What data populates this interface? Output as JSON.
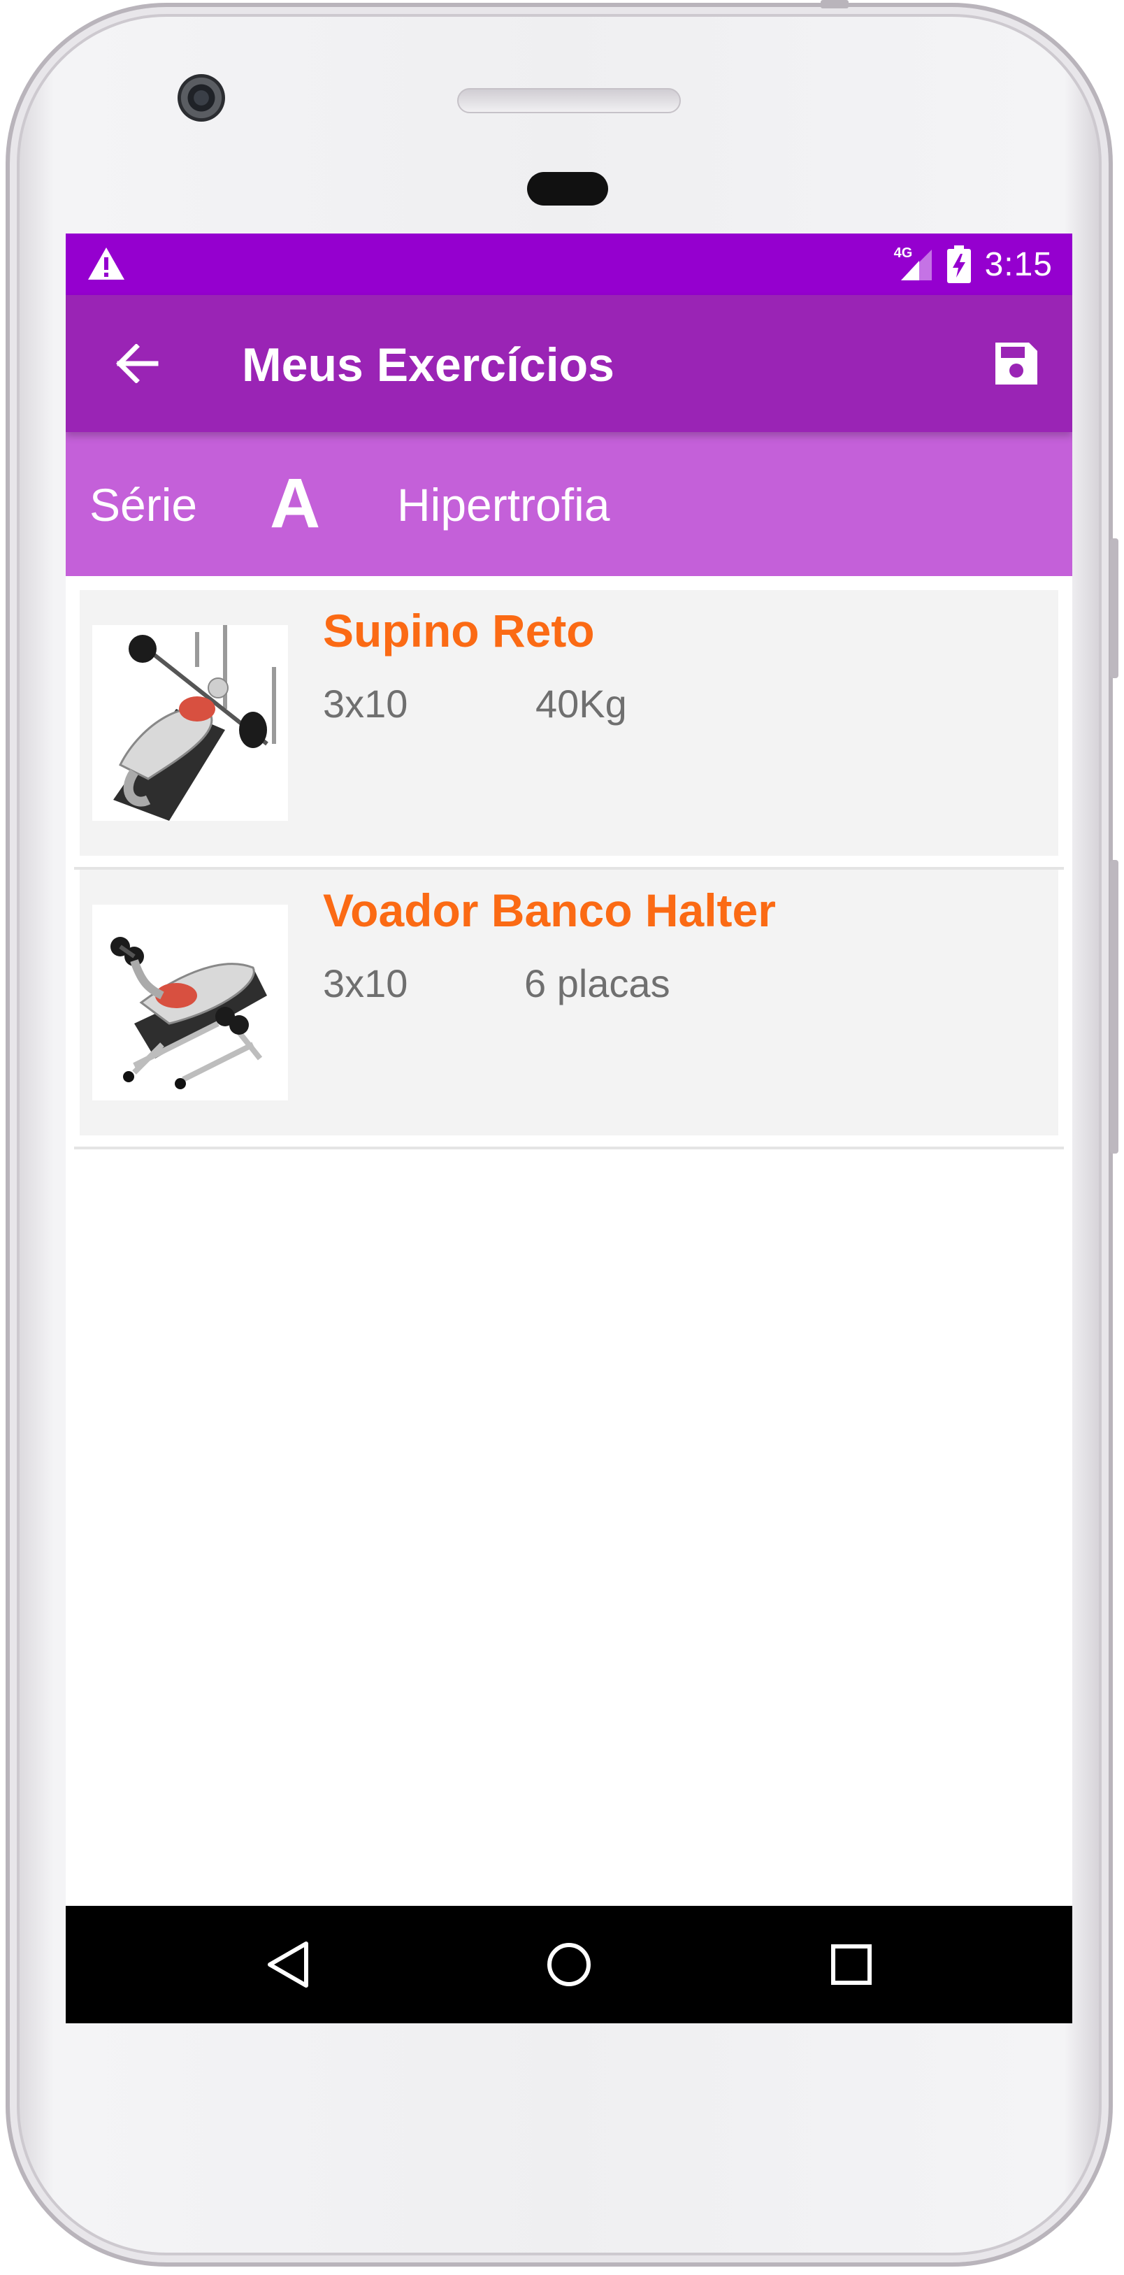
{
  "status_bar": {
    "network": "4G",
    "time": "3:15",
    "color": "#9500cf"
  },
  "app_bar": {
    "title": "Meus Exercícios",
    "color": "#9a24b5",
    "back_icon": "arrow-left-icon",
    "save_icon": "floppy-disk-icon"
  },
  "series": {
    "label": "Série",
    "letter": "A",
    "type": "Hipertrofia",
    "color": "#c460d9"
  },
  "exercises": [
    {
      "name": "Supino Reto",
      "sets": "3x10",
      "load": "40Kg",
      "image": "barbell-bench-press-illustration"
    },
    {
      "name": "Voador Banco Halter",
      "sets": "3x10",
      "load": "6 placas",
      "image": "dumbbell-fly-illustration"
    }
  ],
  "accent_color": "#fb6a14",
  "nav_bar": {
    "back_icon": "triangle-back-icon",
    "home_icon": "circle-home-icon",
    "recents_icon": "square-recents-icon"
  }
}
